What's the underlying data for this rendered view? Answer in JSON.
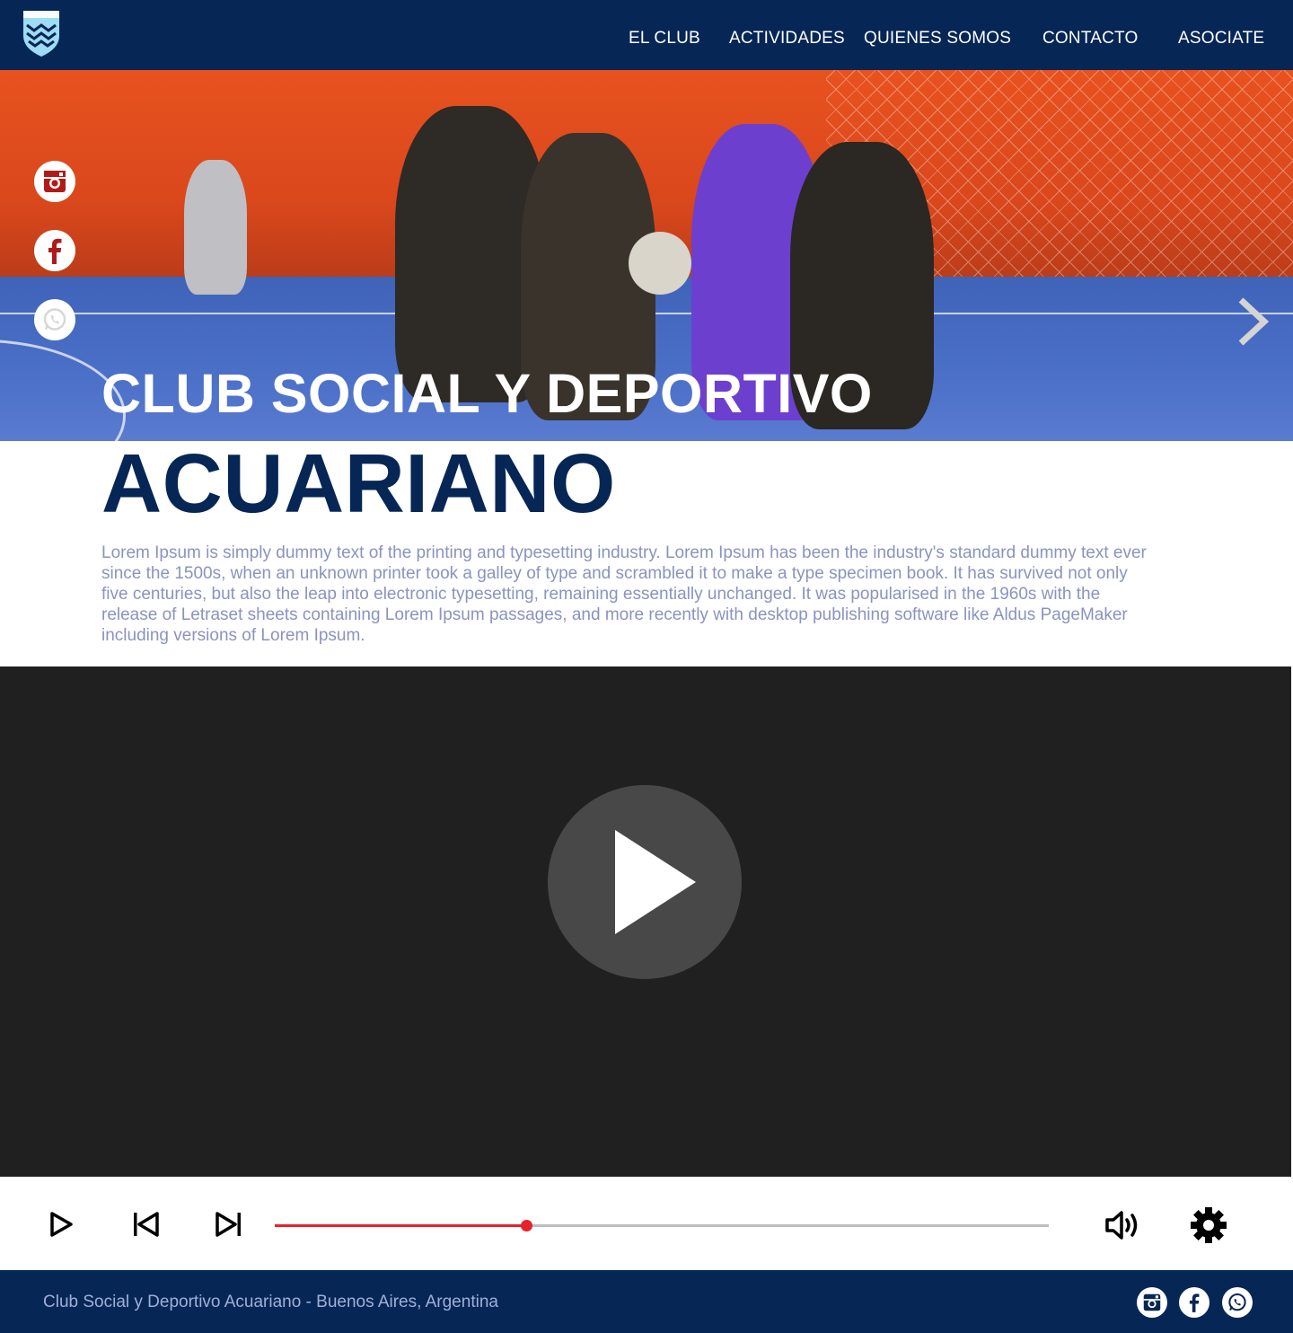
{
  "header": {
    "nav": [
      {
        "label": "EL CLUB"
      },
      {
        "label": "ACTIVIDADES"
      },
      {
        "label": "QUIENES SOMOS"
      },
      {
        "label": "CONTACTO"
      },
      {
        "label": "ASOCIATE"
      }
    ],
    "logo_icon": "club-shield-logo",
    "colors": {
      "navy": "#062656",
      "logo": "#9edcf4"
    }
  },
  "hero": {
    "title": "CLUB SOCIAL Y DEPORTIVO",
    "next_icon": "chevron-right-icon",
    "social": [
      {
        "icon": "instagram-icon"
      },
      {
        "icon": "facebook-icon"
      },
      {
        "icon": "whatsapp-icon"
      }
    ]
  },
  "intro": {
    "title": "ACUARIANO",
    "body": "Lorem Ipsum is simply dummy text of the printing and typesetting industry. Lorem Ipsum has been the industry's standard dummy text ever since the 1500s, when an unknown printer took a galley of type and scrambled it to make a type specimen book. It has survived not only five centuries, but also the leap into electronic typesetting, remaining essentially unchanged. It was popularised in the 1960s with the release of Letraset sheets containing Lorem Ipsum passages, and more recently with desktop publishing software like Aldus PageMaker including versions of Lorem Ipsum."
  },
  "video": {
    "progress": 0.325,
    "colors": {
      "background": "#202020",
      "progress": "#e8212b",
      "track": "#bdbdbd"
    },
    "controls": [
      "play-icon",
      "skip-back-icon",
      "skip-forward-icon",
      "volume-icon",
      "gear-icon"
    ]
  },
  "footer": {
    "text": "Club Social y Deportivo Acuariano - Buenos Aires, Argentina",
    "social": [
      {
        "icon": "instagram-icon"
      },
      {
        "icon": "facebook-icon"
      },
      {
        "icon": "whatsapp-icon"
      }
    ]
  }
}
